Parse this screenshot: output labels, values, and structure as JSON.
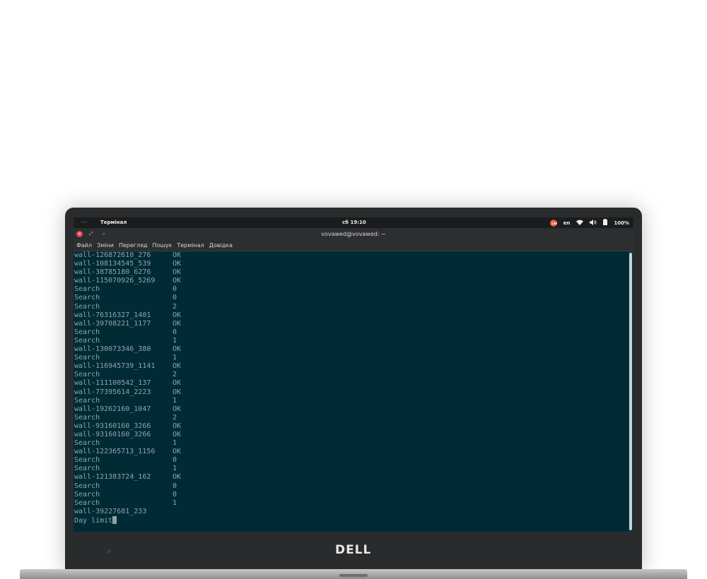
{
  "topbar": {
    "activities": "···",
    "app_name": "Термінал",
    "clock": "сб 19:10",
    "browser_badge": "136",
    "keyboard_layout": "en",
    "battery": "100%",
    "icons": [
      "browser-icon",
      "wifi-icon",
      "volume-icon",
      "battery-icon"
    ]
  },
  "window": {
    "title": "vovawed@vovawed: ~"
  },
  "menu": [
    "Файл",
    "Зміни",
    "Перегляд",
    "Пошук",
    "Термінал",
    "Довідка"
  ],
  "terminal": {
    "lines": [
      {
        "a": "wall-126872610_276",
        "b": "OK"
      },
      {
        "a": "wall-108134545_539",
        "b": "OK"
      },
      {
        "a": "wall-38785180_6276",
        "b": "OK"
      },
      {
        "a": "wall-115070926_5269",
        "b": "OK"
      },
      {
        "a": "Search",
        "b": "0"
      },
      {
        "a": "Search",
        "b": "0"
      },
      {
        "a": "Search",
        "b": "2"
      },
      {
        "a": "wall-76316327_1401",
        "b": "OK"
      },
      {
        "a": "wall-39708221_1177",
        "b": "OK"
      },
      {
        "a": "Search",
        "b": "0"
      },
      {
        "a": "Search",
        "b": "1"
      },
      {
        "a": "wall-130073346_380",
        "b": "OK"
      },
      {
        "a": "Search",
        "b": "1"
      },
      {
        "a": "wall-116945739_1141",
        "b": "OK"
      },
      {
        "a": "Search",
        "b": "2"
      },
      {
        "a": "wall-111100542_137",
        "b": "OK"
      },
      {
        "a": "wall-77395614_2223",
        "b": "OK"
      },
      {
        "a": "Search",
        "b": "1"
      },
      {
        "a": "wall-19262160_1047",
        "b": "OK"
      },
      {
        "a": "Search",
        "b": "2"
      },
      {
        "a": "wall-93160160_3266",
        "b": "OK"
      },
      {
        "a": "wall-93160160_3266",
        "b": "OK"
      },
      {
        "a": "Search",
        "b": "1"
      },
      {
        "a": "wall-122365713_1156",
        "b": "OK"
      },
      {
        "a": "Search",
        "b": "0"
      },
      {
        "a": "Search",
        "b": "1"
      },
      {
        "a": "wall-121383724_162",
        "b": "OK"
      },
      {
        "a": "Search",
        "b": "0"
      },
      {
        "a": "Search",
        "b": "0"
      },
      {
        "a": "Search",
        "b": "1"
      },
      {
        "a": "wall-39227681_233",
        "b": ""
      },
      {
        "a": "Day limit",
        "b": ""
      }
    ]
  },
  "bezel": {
    "brand": "DELL"
  }
}
